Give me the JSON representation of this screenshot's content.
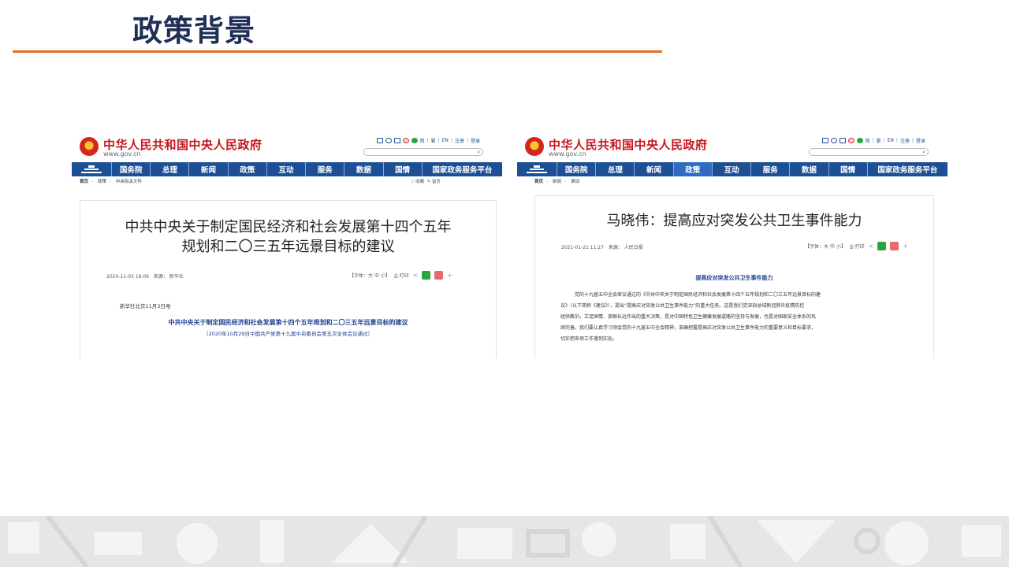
{
  "slide": {
    "title": "政策背景"
  },
  "gov_site": {
    "name": "中华人民共和国中央人民政府",
    "url": "www.gov.cn",
    "util_links": [
      "简",
      "繁",
      "EN",
      "注册",
      "登录"
    ],
    "search_icon": "⌕",
    "nav": [
      "国务院",
      "总理",
      "新闻",
      "政策",
      "互动",
      "服务",
      "数据",
      "国情",
      "国家政务服务平台"
    ]
  },
  "left_page": {
    "breadcrumb": [
      "首页",
      "政策",
      "中央有关文件"
    ],
    "tools": [
      "☆ 收藏",
      "✎ 留言"
    ],
    "title_line1": "中共中央关于制定国民经济和社会发展第十四个五年",
    "title_line2": "规划和二〇三五年远景目标的建议",
    "date": "2020-11-03 18:06",
    "source": "来源： 新华社",
    "font_size_label": "【字体：大 中 小】",
    "print_label": "⎙ 打印",
    "dateline": "新华社北京11月3日电",
    "doc_title": "中共中央关于制定国民经济和社会发展第十四个五年规划和二〇三五年远景目标的建议",
    "doc_sub": "（2020年10月29日中国共产党第十九届中央委员会第五次全体会议通过）"
  },
  "right_page": {
    "breadcrumb": [
      "首页",
      "新闻",
      "滚动"
    ],
    "active_nav": "政策",
    "title": "马晓伟：提高应对突发公共卫生事件能力",
    "date": "2021-01-21 11:27",
    "source": "来源： 人民日报",
    "font_size_label": "【字体：大 中 小】",
    "print_label": "⎙ 打印",
    "subheading": "提高应对突发公共卫生事件能力",
    "para1": "党的十九届五中全会审议通过的《中共中央关于制定国民经济和社会发展第十四个五年规划和二〇三五年远景目标的建",
    "para2": "议》（以下简称《建议》），提出“提高应对突发公共卫生事件能力”的重大任务。这是我们党深刻总结新冠肺炎疫情防控",
    "para3": "经验教训，立足国情、放眼长远作出的重大决策，是对中国特色卫生健康发展道路的坚持与发展，也是对国家安全体系的巩",
    "para4": "固完善。我们要认真学习领会党的十九届五中全会精神，准确把握提高应对突发公共卫生事件能力的重要意义和目标要求，",
    "para5": "切实把各项工作落到实处。"
  },
  "colors": {
    "title": "#1f2f56",
    "rule": "#e2701e",
    "nav": "#1d4f96",
    "site_red": "#c8161d",
    "doc_blue": "#1f3f8f"
  }
}
